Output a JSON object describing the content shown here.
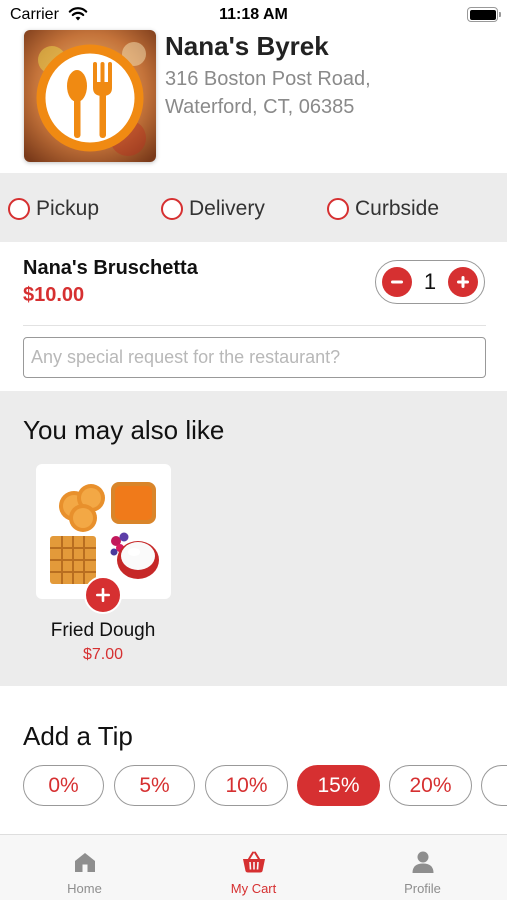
{
  "status_bar": {
    "carrier": "Carrier",
    "time": "11:18 AM"
  },
  "restaurant": {
    "name": "Nana's Byrek",
    "address_line1": "316 Boston Post Road,",
    "address_line2": "Waterford, CT, 06385",
    "logo_icon": "fork-spoon-icon"
  },
  "order_types": [
    {
      "label": "Pickup",
      "selected": false
    },
    {
      "label": "Delivery",
      "selected": false
    },
    {
      "label": "Curbside",
      "selected": false
    }
  ],
  "cart_item": {
    "name": "Nana's Bruschetta",
    "price": "$10.00",
    "quantity": "1"
  },
  "special_request": {
    "placeholder": "Any special request for the restaurant?",
    "value": ""
  },
  "suggestions": {
    "title": "You may also like",
    "items": [
      {
        "name": "Fried Dough",
        "price": "$7.00"
      }
    ]
  },
  "tip": {
    "title": "Add a Tip",
    "options": [
      "0%",
      "5%",
      "10%",
      "15%",
      "20%"
    ],
    "selected": "15%"
  },
  "tabs": [
    {
      "label": "Home",
      "icon": "home-icon",
      "active": false
    },
    {
      "label": "My Cart",
      "icon": "basket-icon",
      "active": true
    },
    {
      "label": "Profile",
      "icon": "person-icon",
      "active": false
    }
  ],
  "colors": {
    "accent": "#d63031",
    "section_bg": "#ececec",
    "muted_text": "#8a8a8a"
  }
}
